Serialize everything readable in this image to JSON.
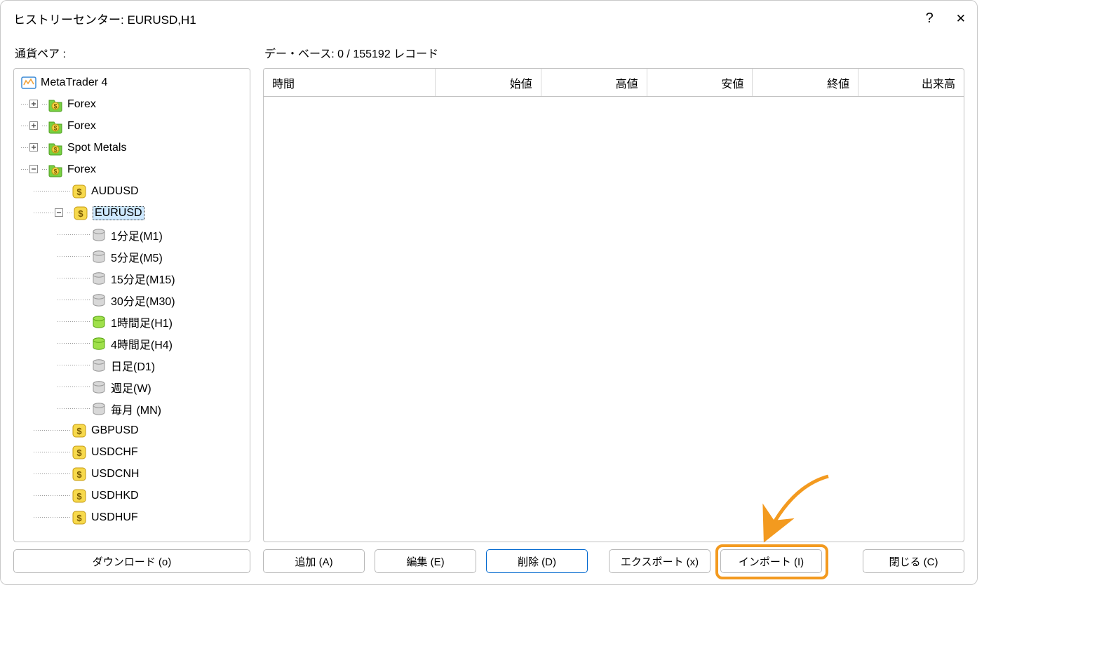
{
  "window": {
    "title": "ヒストリーセンター: EURUSD,H1",
    "help_icon": "?",
    "close_icon": "✕"
  },
  "left": {
    "label": "通貨ペア :",
    "root": "MetaTrader 4",
    "groups": [
      {
        "name": "Forex",
        "expanded": false
      },
      {
        "name": "Forex",
        "expanded": false
      },
      {
        "name": "Spot Metals",
        "expanded": false
      },
      {
        "name": "Forex",
        "expanded": true
      }
    ],
    "symbols_in_open_group": [
      "AUDUSD",
      "EURUSD",
      "GBPUSD",
      "USDCHF",
      "USDCNH",
      "USDHKD",
      "USDHUF"
    ],
    "selected_symbol": "EURUSD",
    "timeframes_of_selected": [
      {
        "label": "1分足(M1)",
        "loaded": false
      },
      {
        "label": "5分足(M5)",
        "loaded": false
      },
      {
        "label": "15分足(M15)",
        "loaded": false
      },
      {
        "label": "30分足(M30)",
        "loaded": false
      },
      {
        "label": "1時間足(H1)",
        "loaded": true
      },
      {
        "label": "4時間足(H4)",
        "loaded": true
      },
      {
        "label": "日足(D1)",
        "loaded": false
      },
      {
        "label": "週足(W)",
        "loaded": false
      },
      {
        "label": "毎月 (MN)",
        "loaded": false
      }
    ]
  },
  "right": {
    "label": "デー・ベース: 0 / 155192 レコード",
    "columns": [
      "時間",
      "始値",
      "高値",
      "安値",
      "終値",
      "出来高"
    ]
  },
  "buttons": {
    "download": "ダウンロード (o)",
    "add": "追加 (A)",
    "edit": "編集 (E)",
    "delete": "削除 (D)",
    "export": "エクスポート (x)",
    "import": "インポート (I)",
    "close": "閉じる (C)"
  }
}
